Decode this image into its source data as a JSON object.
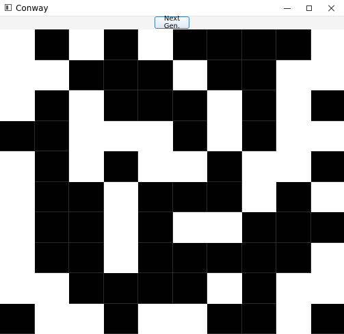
{
  "window": {
    "title": "Conway"
  },
  "icons": {
    "app": "app-window-icon",
    "minimize": "minimize-icon",
    "maximize": "maximize-icon",
    "close": "close-icon"
  },
  "toolbar": {
    "next_label": "Next Gen."
  },
  "colors": {
    "alive": "#000000",
    "dead": "#ffffff",
    "button_border": "#3c7fb1"
  },
  "board": {
    "rows": 9,
    "cols": 10,
    "cells": [
      [
        0,
        1,
        0,
        1,
        0,
        1,
        1,
        1,
        1,
        0
      ],
      [
        0,
        0,
        1,
        1,
        1,
        0,
        1,
        1,
        0,
        0
      ],
      [
        0,
        1,
        0,
        1,
        1,
        1,
        0,
        1,
        0,
        1
      ],
      [
        1,
        1,
        0,
        0,
        0,
        1,
        0,
        1,
        0,
        0
      ],
      [
        0,
        1,
        0,
        1,
        0,
        0,
        1,
        0,
        0,
        1
      ],
      [
        0,
        1,
        1,
        0,
        1,
        1,
        1,
        0,
        1,
        0
      ],
      [
        0,
        1,
        1,
        0,
        1,
        0,
        0,
        1,
        1,
        1
      ],
      [
        0,
        1,
        1,
        0,
        1,
        1,
        1,
        1,
        1,
        0
      ],
      [
        0,
        0,
        1,
        1,
        1,
        1,
        0,
        1,
        0,
        0
      ],
      [
        1,
        0,
        0,
        1,
        0,
        0,
        1,
        1,
        0,
        1
      ]
    ]
  }
}
